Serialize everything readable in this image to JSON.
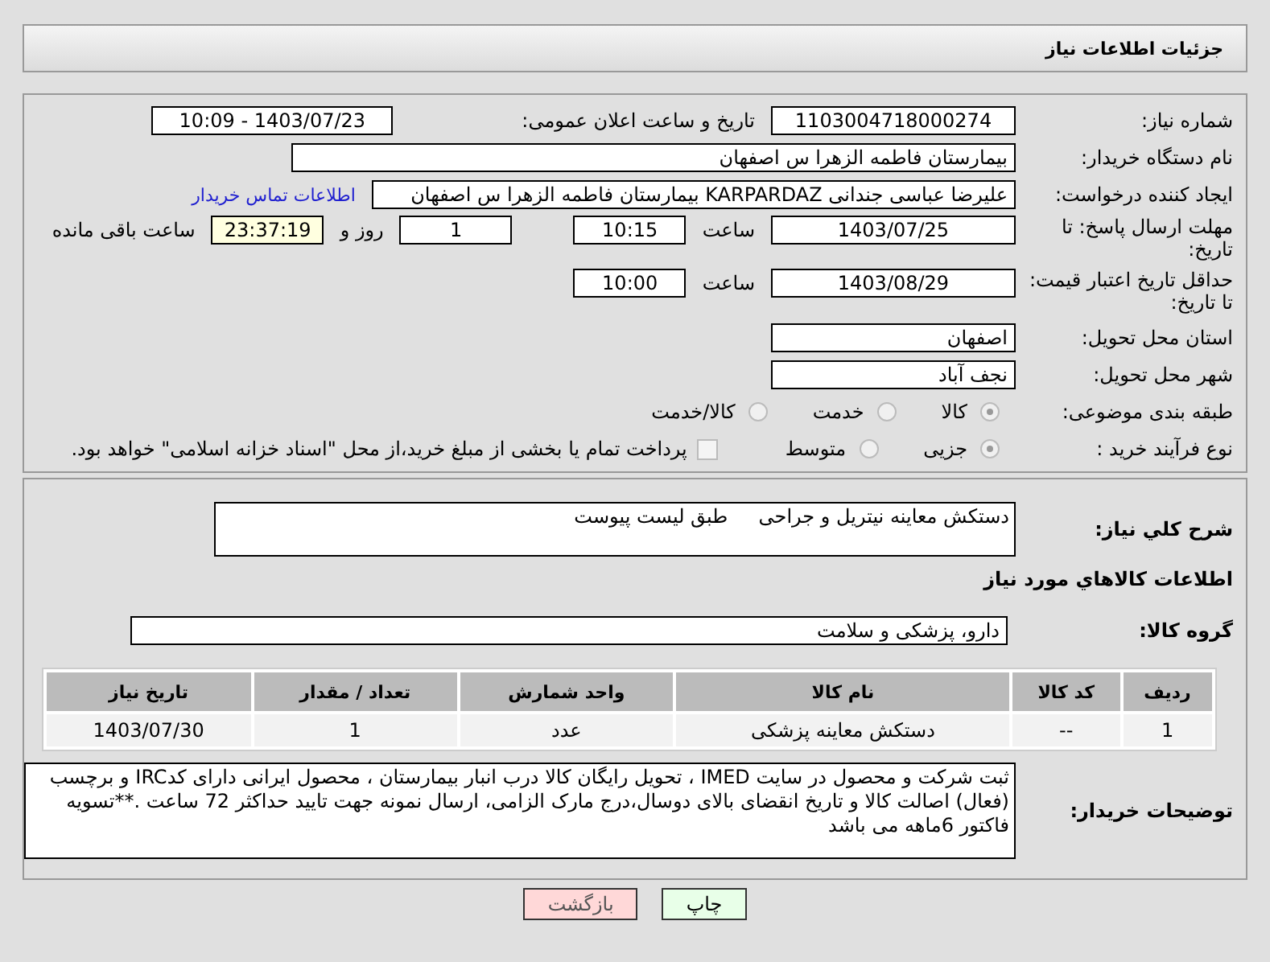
{
  "header": {
    "title": "جزئیات اطلاعات نیاز"
  },
  "need_number": {
    "label": "شماره نیاز:",
    "value": "1103004718000274"
  },
  "announce": {
    "label": "تاریخ و ساعت اعلان عمومی:",
    "value": "1403/07/23 - 10:09"
  },
  "buyer_org": {
    "label": "نام دستگاه خریدار:",
    "value": "بیمارستان فاطمه الزهرا س  اصفهان"
  },
  "requester": {
    "label": "ایجاد کننده درخواست:",
    "value": "علیرضا عباسی جندانی KARPARDAZ بیمارستان فاطمه الزهرا س  اصفهان",
    "link": "اطلاعات تماس خریدار"
  },
  "deadline": {
    "label": "مهلت ارسال پاسخ: تا تاریخ:",
    "date": "1403/07/25",
    "time_label": "ساعت",
    "time": "10:15",
    "days": "1",
    "days_label": "روز و",
    "countdown": "23:37:19",
    "remaining_label": "ساعت باقی مانده"
  },
  "validity": {
    "label": "حداقل تاریخ اعتبار قیمت: تا تاریخ:",
    "date": "1403/08/29",
    "time_label": "ساعت",
    "time": "10:00"
  },
  "province": {
    "label": "استان محل تحویل:",
    "value": "اصفهان"
  },
  "city": {
    "label": "شهر محل تحویل:",
    "value": "نجف آباد"
  },
  "category": {
    "label": "طبقه بندی موضوعی:",
    "options": [
      {
        "label": "کالا",
        "selected": true
      },
      {
        "label": "خدمت",
        "selected": false
      },
      {
        "label": "کالا/خدمت",
        "selected": false
      }
    ]
  },
  "purchase_type": {
    "label": "نوع فرآیند خرید :",
    "options": [
      {
        "label": "جزیی",
        "selected": true
      },
      {
        "label": "متوسط",
        "selected": false
      }
    ],
    "treasury": {
      "label": "پرداخت تمام یا بخشی از مبلغ خرید،از محل \"اسناد خزانه اسلامی\" خواهد بود.",
      "checked": false
    }
  },
  "description": {
    "label": "شرح کلي نياز:",
    "value": "دستکش معاینه نیتریل و جراحی     طبق لیست پیوست"
  },
  "goods_title": "اطلاعات کالاهاي مورد نياز",
  "goods_group": {
    "label": "گروه کالا:",
    "value": "دارو، پزشکی و سلامت"
  },
  "table": {
    "columns": [
      "ردیف",
      "کد کالا",
      "نام کالا",
      "واحد شمارش",
      "تعداد / مقدار",
      "تاریخ نیاز"
    ],
    "rows": [
      [
        "1",
        "--",
        "دستکش معاینه پزشکی",
        "عدد",
        "1",
        "1403/07/30"
      ]
    ]
  },
  "buyer_notes": {
    "label": "توضیحات خریدار:",
    "value": "ثبت شرکت و محصول در سایت IMED ، تحویل رایگان کالا درب انبار بیمارستان ، محصول ایرانی دارای کدIRC و برچسب (فعال) اصالت کالا و تاریخ انقضای بالای دوسال،درج مارک الزامی،  ارسال نمونه جهت تایید حداکثر 72 ساعت .**تسویه فاکتور 6ماهه می باشد"
  },
  "buttons": [
    {
      "label": "چاپ",
      "kind": "print"
    },
    {
      "label": "بازگشت",
      "kind": "back"
    }
  ]
}
